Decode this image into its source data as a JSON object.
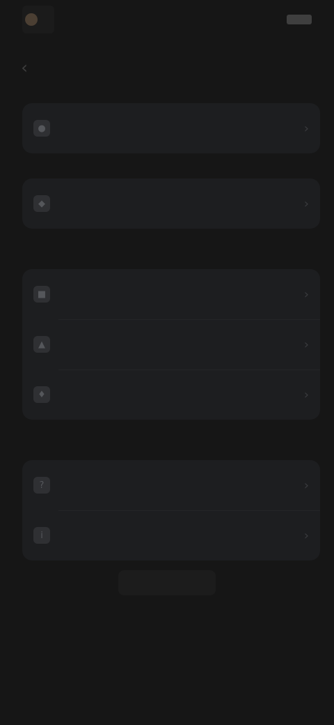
{
  "status_bar": {
    "carrier": "",
    "right_text": ""
  },
  "nav": {
    "back_glyph": "‹",
    "title": ""
  },
  "account_card": {
    "items": [
      {
        "label": "",
        "icon": "person-icon"
      }
    ]
  },
  "section_1": {
    "header": "",
    "items": [
      {
        "label": "",
        "icon": "bell-icon"
      }
    ]
  },
  "section_2": {
    "header": "",
    "items": [
      {
        "label": "",
        "icon": "lock-icon"
      },
      {
        "label": "",
        "icon": "shield-icon"
      },
      {
        "label": "",
        "icon": "key-icon"
      }
    ]
  },
  "section_3": {
    "header": "",
    "items": [
      {
        "label": "",
        "icon": "help-icon"
      },
      {
        "label": "",
        "icon": "info-icon"
      }
    ]
  },
  "footer": {
    "button_label": "",
    "note": ""
  },
  "icons": {
    "chevron": "›"
  },
  "colors": {
    "background": "#161616",
    "card": "#1d1e20",
    "accent_dot": "#4b3f33"
  }
}
